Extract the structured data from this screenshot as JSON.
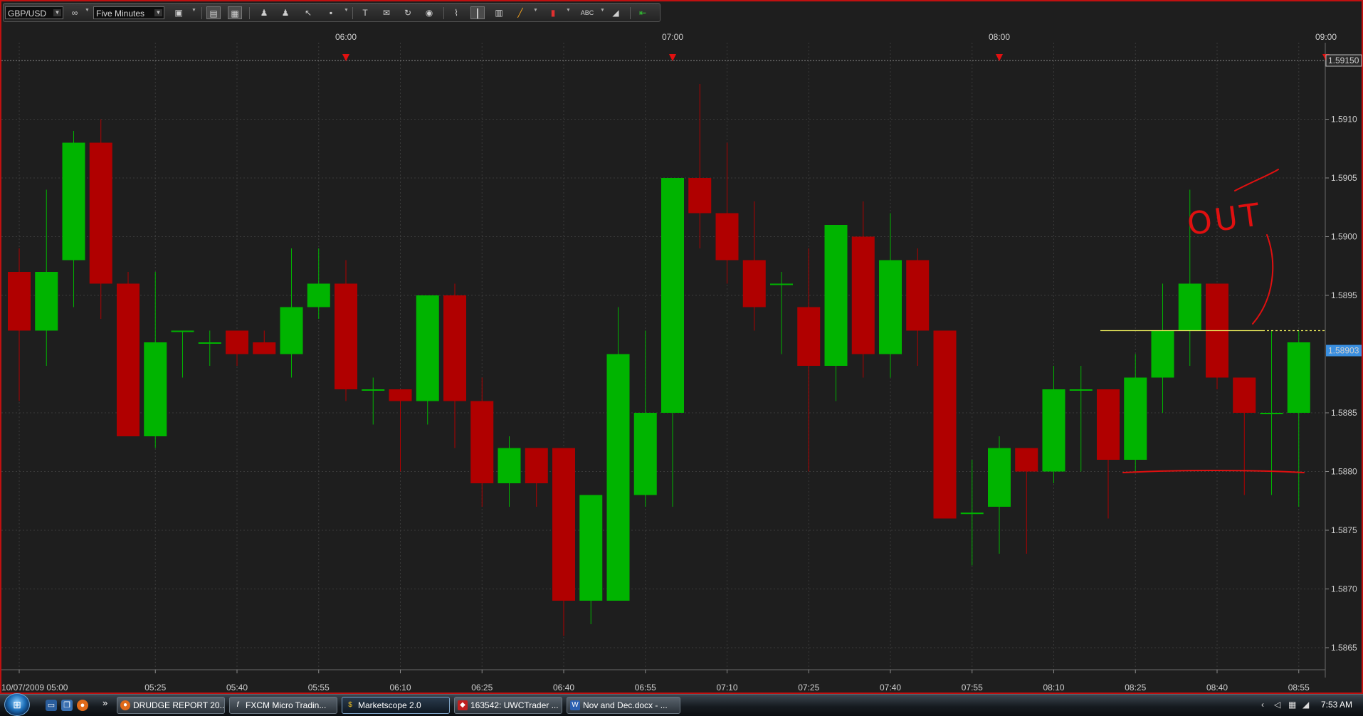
{
  "toolbar": {
    "symbol": "GBP/USD",
    "timeframe": "Five Minutes",
    "icons": [
      "chart-type-icon",
      "period-1-icon",
      "period-2-icon",
      "person-icon",
      "person-add-icon",
      "cursor-icon",
      "crosshair-icon",
      "text-icon",
      "comment-icon",
      "refresh-icon",
      "globe-icon",
      "trend-icon",
      "vertical-line-icon",
      "channel-icon",
      "pencil-icon",
      "marker-icon",
      "label-icon",
      "eraser-icon",
      "arrow-icon"
    ]
  },
  "chart": {
    "top_time_labels": [
      "06:00",
      "07:00",
      "08:00",
      "09:00"
    ],
    "bottom_time_labels": [
      "10/07/2009 05:00",
      "05:25",
      "05:40",
      "05:55",
      "06:10",
      "06:25",
      "06:40",
      "06:55",
      "07:10",
      "07:25",
      "07:40",
      "07:55",
      "08:10",
      "08:25",
      "08:40",
      "08:55"
    ],
    "price_labels": [
      "1.5910",
      "1.5905",
      "1.5900",
      "1.5895",
      "1.5885",
      "1.5880",
      "1.5875",
      "1.5870",
      "1.5865"
    ],
    "price_top_tag": "1.59150",
    "price_current_tag": "1.58903",
    "annotation_text": "OUT",
    "colors": {
      "up": "#00b400",
      "down": "#b00000",
      "background": "#1e1e1e",
      "grid": "#3a3a3a",
      "level": "#e8e85a",
      "ink": "#e01010",
      "current_tag": "#3a8fe0"
    }
  },
  "chart_data": {
    "type": "candlestick",
    "title": "",
    "symbol": "GBP/USD",
    "timeframe": "Five Minutes",
    "ylim": [
      1.5862,
      1.5918
    ],
    "current_price": 1.58903,
    "top_marker_price": 1.5915,
    "x": [
      "05:00",
      "05:05",
      "05:10",
      "05:15",
      "05:20",
      "05:25",
      "05:30",
      "05:35",
      "05:40",
      "05:45",
      "05:50",
      "05:55",
      "06:00",
      "06:05",
      "06:10",
      "06:15",
      "06:20",
      "06:25",
      "06:30",
      "06:35",
      "06:40",
      "06:45",
      "06:50",
      "06:55",
      "07:00",
      "07:05",
      "07:10",
      "07:15",
      "07:20",
      "07:25",
      "07:30",
      "07:35",
      "07:40",
      "07:45",
      "07:50",
      "07:55",
      "08:00",
      "08:05",
      "08:10",
      "08:15",
      "08:20",
      "08:25",
      "08:30",
      "08:35",
      "08:40",
      "08:45",
      "08:50",
      "08:55"
    ],
    "open": [
      1.5897,
      1.5892,
      1.5898,
      1.5908,
      1.5896,
      1.5883,
      1.5892,
      1.5891,
      1.5892,
      1.5891,
      1.589,
      1.5894,
      1.5896,
      1.5887,
      1.5887,
      1.5886,
      1.5895,
      1.5886,
      1.5879,
      1.5882,
      1.5882,
      1.5869,
      1.5869,
      1.5878,
      1.5885,
      1.5905,
      1.5902,
      1.5898,
      1.5896,
      1.5894,
      1.5889,
      1.59,
      1.589,
      1.5898,
      1.5892,
      1.58765,
      1.5877,
      1.5882,
      1.588,
      1.5887,
      1.5887,
      1.5881,
      1.5888,
      1.5892,
      1.5896,
      1.5888,
      1.5885,
      1.5885
    ],
    "high": [
      1.5899,
      1.5904,
      1.5909,
      1.591,
      1.5897,
      1.5897,
      1.5892,
      1.5892,
      1.5892,
      1.5892,
      1.5899,
      1.5899,
      1.5898,
      1.5888,
      1.5887,
      1.5895,
      1.5896,
      1.5888,
      1.5883,
      1.5882,
      1.5882,
      1.5878,
      1.5894,
      1.5892,
      1.5905,
      1.5913,
      1.5908,
      1.5903,
      1.5897,
      1.5899,
      1.5894,
      1.5903,
      1.5902,
      1.5899,
      1.5892,
      1.5881,
      1.5883,
      1.5882,
      1.5889,
      1.5889,
      1.5887,
      1.589,
      1.5896,
      1.5904,
      1.5896,
      1.5888,
      1.5892,
      1.5892
    ],
    "low": [
      1.5886,
      1.5889,
      1.5894,
      1.5893,
      1.5883,
      1.5882,
      1.5888,
      1.5889,
      1.5889,
      1.589,
      1.5888,
      1.5893,
      1.5886,
      1.5884,
      1.588,
      1.5884,
      1.5882,
      1.5877,
      1.5877,
      1.5877,
      1.5866,
      1.5867,
      1.5876,
      1.5877,
      1.5877,
      1.5899,
      1.5896,
      1.5892,
      1.589,
      1.588,
      1.5886,
      1.5888,
      1.5888,
      1.5889,
      1.5876,
      1.5872,
      1.5873,
      1.5873,
      1.5879,
      1.588,
      1.5876,
      1.588,
      1.5885,
      1.5889,
      1.5887,
      1.5878,
      1.5878,
      1.5877
    ],
    "close": [
      1.5892,
      1.5897,
      1.5908,
      1.5896,
      1.5883,
      1.5891,
      1.5892,
      1.5891,
      1.589,
      1.589,
      1.5894,
      1.5896,
      1.5887,
      1.5887,
      1.5886,
      1.5895,
      1.5886,
      1.5879,
      1.5882,
      1.5879,
      1.5869,
      1.5878,
      1.589,
      1.5885,
      1.5905,
      1.5902,
      1.5898,
      1.5894,
      1.5896,
      1.5889,
      1.5901,
      1.589,
      1.5898,
      1.5892,
      1.5876,
      1.58765,
      1.5882,
      1.588,
      1.5887,
      1.5887,
      1.5881,
      1.5888,
      1.5892,
      1.5896,
      1.5888,
      1.5885,
      1.5885,
      1.5891
    ],
    "horizontal_line_price": 1.5892,
    "time_markers": [
      "06:00",
      "07:00",
      "08:00",
      "09:00"
    ],
    "annotations": [
      "OUT"
    ]
  },
  "taskbar": {
    "items": [
      {
        "label": "DRUDGE REPORT 20...",
        "icon": "firefox-icon"
      },
      {
        "label": "FXCM Micro Tradin...",
        "icon": "fx-icon"
      },
      {
        "label": "Marketscope 2.0",
        "icon": "dollar-icon"
      },
      {
        "label": "163542: UWCTrader ...",
        "icon": "chat-icon"
      },
      {
        "label": "Nov and Dec.docx - ...",
        "icon": "word-icon"
      }
    ],
    "clock": "7:53 AM",
    "chevron": "»"
  }
}
